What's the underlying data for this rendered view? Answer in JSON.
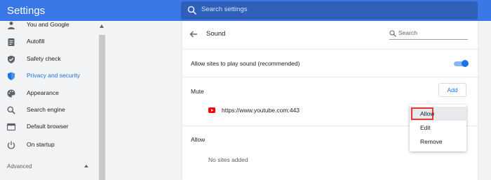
{
  "app": {
    "title": "Settings"
  },
  "header": {
    "search_placeholder": "Search settings"
  },
  "sidebar": {
    "items": [
      {
        "label": "You and Google",
        "icon": "person-icon",
        "active": false
      },
      {
        "label": "Autofill",
        "icon": "clipboard-icon",
        "active": false
      },
      {
        "label": "Safety check",
        "icon": "shield-check-icon",
        "active": false
      },
      {
        "label": "Privacy and security",
        "icon": "shield-icon",
        "active": true
      },
      {
        "label": "Appearance",
        "icon": "palette-icon",
        "active": false
      },
      {
        "label": "Search engine",
        "icon": "search-icon",
        "active": false
      },
      {
        "label": "Default browser",
        "icon": "browser-icon",
        "active": false
      },
      {
        "label": "On startup",
        "icon": "power-icon",
        "active": false
      }
    ],
    "advanced_label": "Advanced"
  },
  "page": {
    "title": "Sound",
    "search_placeholder": "Search",
    "allow_sound_label": "Allow sites to play sound (recommended)",
    "allow_sound_enabled": true,
    "mute_label": "Mute",
    "add_button_label": "Add",
    "muted_sites": [
      {
        "url": "https://www.youtube.com:443",
        "icon": "youtube-icon"
      }
    ],
    "allow_label": "Allow",
    "allow_empty_text": "No sites added"
  },
  "context_menu": {
    "items": [
      {
        "label": "Allow",
        "highlighted": true
      },
      {
        "label": "Edit",
        "highlighted": false
      },
      {
        "label": "Remove",
        "highlighted": false
      }
    ]
  },
  "colors": {
    "topbar": "#3b78e7",
    "accent": "#1a73e8",
    "highlight_border": "#e53935",
    "youtube_red": "#ff0000"
  }
}
